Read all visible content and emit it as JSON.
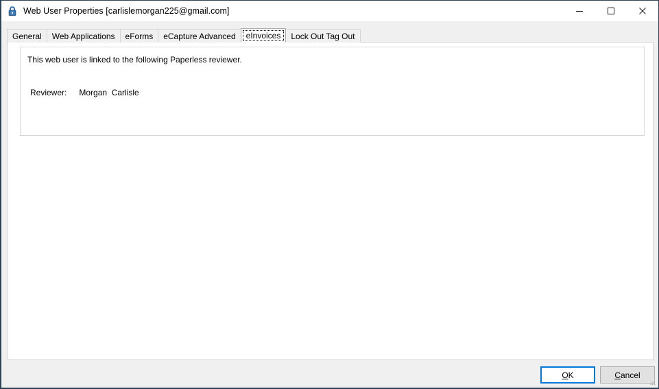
{
  "window": {
    "title": "Web User Properties [carlislemorgan225@gmail.com]",
    "icon": "padlock-icon",
    "controls": {
      "minimize": "Minimize",
      "maximize": "Maximize",
      "close": "Close"
    }
  },
  "tabs": [
    {
      "label": "General",
      "selected": false
    },
    {
      "label": "Web Applications",
      "selected": false
    },
    {
      "label": "eForms",
      "selected": false
    },
    {
      "label": "eCapture Advanced",
      "selected": false
    },
    {
      "label": "eInvoices",
      "selected": true
    },
    {
      "label": "Lock Out Tag Out",
      "selected": false
    }
  ],
  "page": {
    "note": "This web user is linked to the following Paperless reviewer.",
    "reviewer_label": "Reviewer:",
    "reviewer_value": "Morgan  Carlisle"
  },
  "footer": {
    "ok": "OK",
    "ok_mnemonic": "O",
    "cancel": "Cancel",
    "cancel_mnemonic": "C"
  },
  "colors": {
    "accent": "#0078d7",
    "window_border": "#2c4257",
    "surface": "#f0f0f0",
    "panel": "#ffffff",
    "lock_icon": "#2e6da4"
  }
}
